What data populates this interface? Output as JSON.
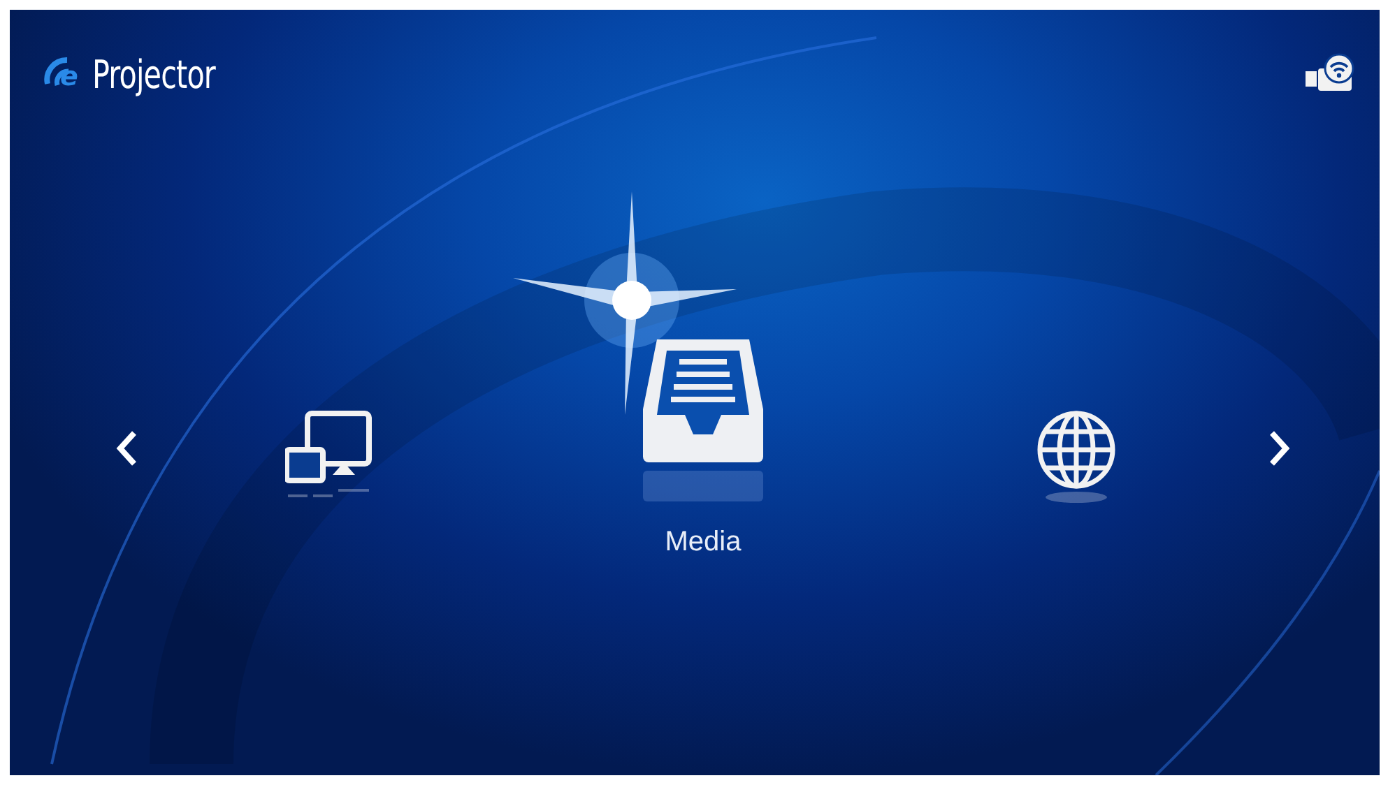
{
  "header": {
    "logo": {
      "mark": "e",
      "name": "Projector"
    }
  },
  "carousel": {
    "items": [
      {
        "kind": "mirror",
        "selected": false
      },
      {
        "kind": "media",
        "selected": true,
        "label": "Media"
      },
      {
        "kind": "web",
        "selected": false
      }
    ]
  }
}
